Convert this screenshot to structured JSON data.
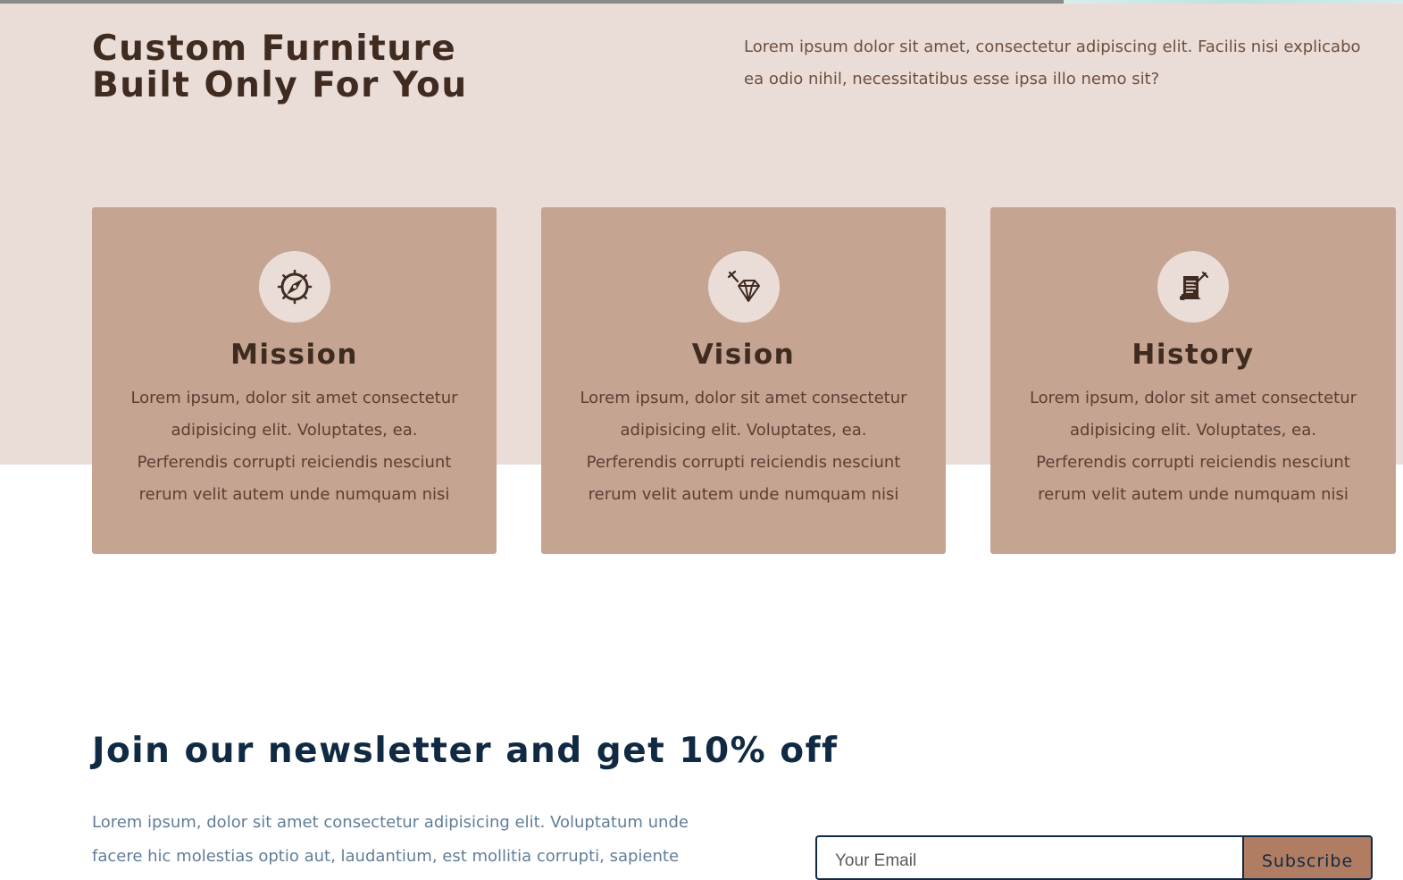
{
  "about": {
    "title_line1": "Custom Furniture",
    "title_line2": "Built Only For You",
    "text": "Lorem ipsum dolor sit amet, consectetur adipiscing elit. Facilis nisi explicabo ea odio nihil, necessitatibus esse ipsa illo nemo sit?"
  },
  "cards": [
    {
      "icon": "compass-icon",
      "title": "Mission",
      "text": "Lorem ipsum, dolor sit amet consectetur adipisicing elit. Voluptates, ea. Perferendis corrupti reiciendis nesciunt rerum velit autem unde numquam nisi"
    },
    {
      "icon": "diamond-icon",
      "title": "Vision",
      "text": "Lorem ipsum, dolor sit amet consectetur adipisicing elit. Voluptates, ea. Perferendis corrupti reiciendis nesciunt rerum velit autem unde numquam nisi"
    },
    {
      "icon": "document-scroll-icon",
      "title": "History",
      "text": "Lorem ipsum, dolor sit amet consectetur adipisicing elit. Voluptates, ea. Perferendis corrupti reiciendis nesciunt rerum velit autem unde numquam nisi"
    }
  ],
  "newsletter": {
    "title": "Join our newsletter and get 10% off",
    "text": "Lorem ipsum, dolor sit amet consectetur adipisicing elit. Voluptatum unde facere hic molestias optio aut, laudantium, est mollitia corrupti, sapiente",
    "email_placeholder": "Your Email",
    "subscribe_label": "Subscribe"
  },
  "colors": {
    "band_background": "#eaddd7",
    "card_background": "#c5a491",
    "heading_brown": "#3f2b20",
    "heading_navy": "#102a43",
    "subscribe_button": "#b07d63"
  }
}
